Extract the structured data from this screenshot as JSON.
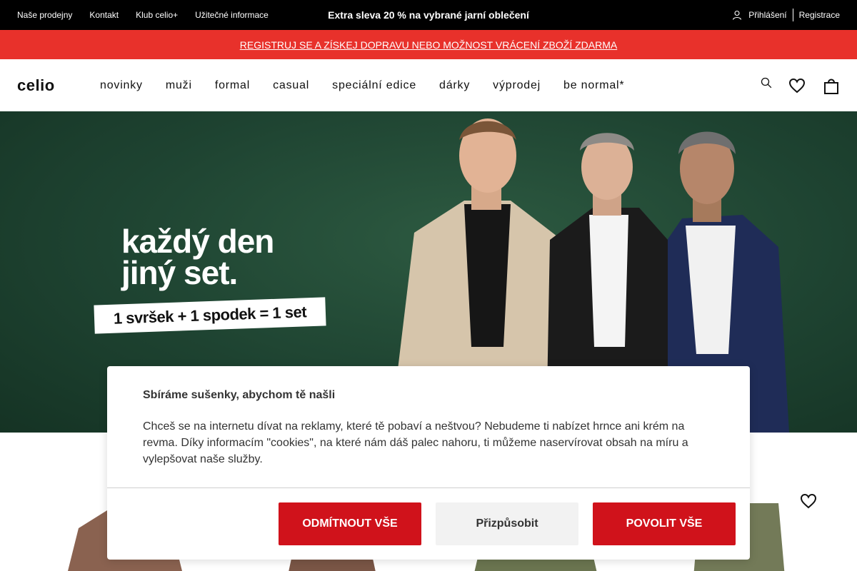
{
  "topbar": {
    "links": [
      "Naše prodejny",
      "Kontakt",
      "Klub celio+",
      "Užitečné informace"
    ],
    "promo": "Extra sleva 20 % na vybrané jarní oblečení ",
    "login": "Přihlášení",
    "register": "Registrace"
  },
  "redbar": {
    "text": "REGISTRUJ SE A ZÍSKEJ DOPRAVU NEBO MOŽNOST VRÁCENÍ ZBOŽÍ ZDARMA"
  },
  "nav": {
    "logo": "celio",
    "menu": [
      "novinky",
      "muži",
      "formal",
      "casual",
      "speciální edice",
      "dárky",
      "výprodej",
      "be normal*"
    ],
    "icons": [
      "search-icon",
      "heart-icon",
      "bag-icon"
    ]
  },
  "hero": {
    "title_line1": "každý den",
    "title_line2": "jiný set.",
    "subtitle": "1 svršek + 1 spodek = 1 set"
  },
  "cookie": {
    "title": "Sbíráme sušenky, abychom tě našli",
    "body": "Chceš se na internetu dívat na reklamy, které tě pobaví a neštvou? Nebudeme ti nabízet hrnce ani krém na revma. Díky informacím \"cookies\", na které nám dáš palec nahoru, ti můžeme naservírovat obsah na míru a vylepšovat naše služby.",
    "reject": "ODMÍTNOUT VŠE",
    "customize": "Přizpůsobit",
    "accept": "POVOLIT VŠE"
  },
  "colors": {
    "topbar_bg": "#000000",
    "redbar_bg": "#e8312b",
    "hero_bg": "#1e4331",
    "button_red": "#d0121b",
    "button_grey": "#f2f2f2"
  }
}
